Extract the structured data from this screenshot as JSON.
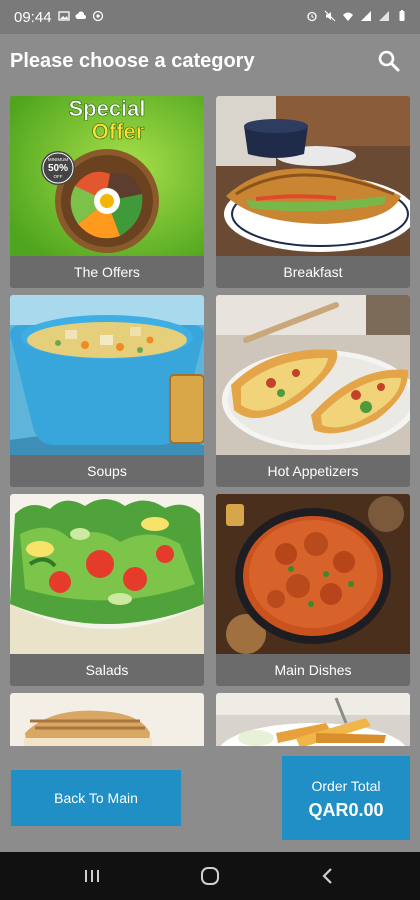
{
  "status_bar": {
    "time": "09:44",
    "left_icons": [
      "image-icon",
      "cloud-icon",
      "vpn-icon"
    ],
    "right_icons": [
      "alarm-icon",
      "mute-icon",
      "wifi-icon",
      "signal-icon",
      "signal-icon",
      "battery-icon"
    ]
  },
  "header": {
    "title": "Please choose a category",
    "search_icon": "search-icon"
  },
  "categories": [
    {
      "label": "The Offers",
      "image": "special-offer-image"
    },
    {
      "label": "Breakfast",
      "image": "croissant-image"
    },
    {
      "label": "Soups",
      "image": "soup-image"
    },
    {
      "label": "Hot Appetizers",
      "image": "stuffed-zucchini-image"
    },
    {
      "label": "Salads",
      "image": "salad-image"
    },
    {
      "label": "Main Dishes",
      "image": "curry-image"
    },
    {
      "label": "",
      "image": "sandwich-image"
    },
    {
      "label": "",
      "image": "fries-image"
    }
  ],
  "offer_image_text": {
    "line1": "Special",
    "line2": "Offer",
    "badge_top": "MINIMUM",
    "badge_value": "50%",
    "badge_bottom": "OFF"
  },
  "footer": {
    "back_label": "Back To Main",
    "order_total_label": "Order Total",
    "order_total_amount": "QAR0.00"
  },
  "nav": {
    "recents_icon": "recents-icon",
    "home_icon": "home-icon",
    "back_icon": "back-icon"
  },
  "colors": {
    "background": "#8c8c8c",
    "accent": "#1f8fc6",
    "card_label_bg": "#6b6b6b",
    "nav_bar": "#111111"
  }
}
